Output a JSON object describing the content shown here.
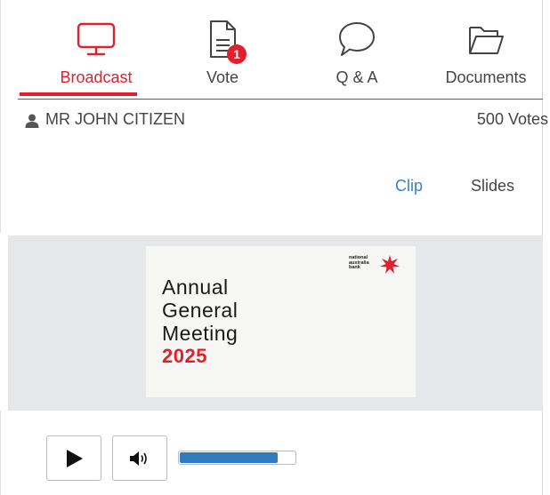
{
  "tabs": [
    {
      "label": "Broadcast",
      "icon": "monitor-icon",
      "active": true
    },
    {
      "label": "Vote",
      "icon": "document-icon",
      "badge": "1"
    },
    {
      "label": "Q & A",
      "icon": "speech-bubble-icon"
    },
    {
      "label": "Documents",
      "icon": "folder-icon"
    }
  ],
  "user": {
    "name": "MR JOHN CITIZEN",
    "votes": "500 Votes",
    "icon": "user-icon"
  },
  "view_toggle": {
    "clip": "Clip",
    "slides": "Slides"
  },
  "slide": {
    "title_line1": "Annual",
    "title_line2": "General",
    "title_line3": "Meeting",
    "year": "2025",
    "logo_line1": "national",
    "logo_line2": "australia",
    "logo_line3": "bank"
  },
  "controls": {
    "play_icon": "play-icon",
    "volume_icon": "speaker-icon",
    "volume_level_percent": 84
  },
  "colors": {
    "accent": "#e0202d",
    "link": "#3b7fc4",
    "volume": "#2f7bbf",
    "media_bg": "#e6e7e9"
  }
}
